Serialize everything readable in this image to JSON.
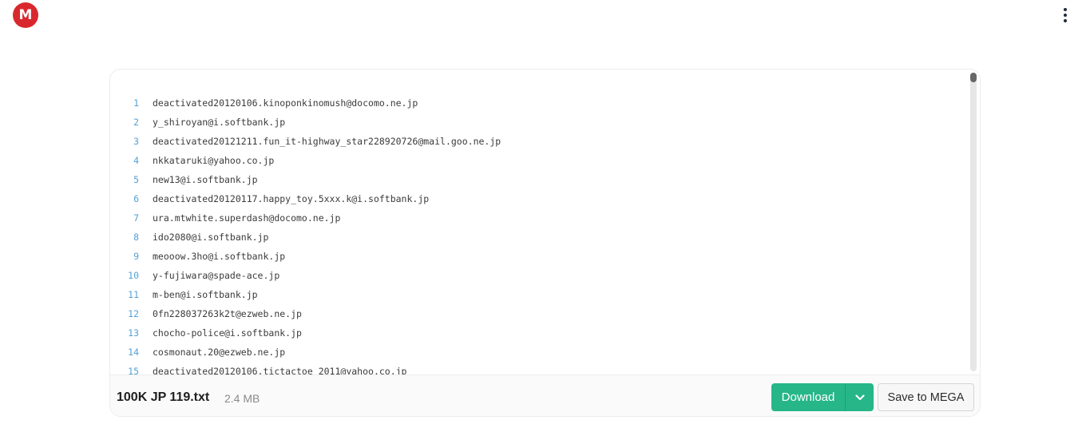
{
  "header": {
    "logo_letter": "M",
    "logo_color": "#d9272e",
    "menu_icon": "kebab-menu-icon"
  },
  "viewer": {
    "lines": [
      {
        "n": "1",
        "text": "deactivated20120106.kinoponkinomush@docomo.ne.jp"
      },
      {
        "n": "2",
        "text": "y_shiroyan@i.softbank.jp"
      },
      {
        "n": "3",
        "text": "deactivated20121211.fun_it-highway_star228920726@mail.goo.ne.jp"
      },
      {
        "n": "4",
        "text": "nkkataruki@yahoo.co.jp"
      },
      {
        "n": "5",
        "text": "new13@i.softbank.jp"
      },
      {
        "n": "6",
        "text": "deactivated20120117.happy_toy.5xxx.k@i.softbank.jp"
      },
      {
        "n": "7",
        "text": "ura.mtwhite.superdash@docomo.ne.jp"
      },
      {
        "n": "8",
        "text": "ido2080@i.softbank.jp"
      },
      {
        "n": "9",
        "text": "meooow.3ho@i.softbank.jp"
      },
      {
        "n": "10",
        "text": "y-fujiwara@spade-ace.jp"
      },
      {
        "n": "11",
        "text": "m-ben@i.softbank.jp"
      },
      {
        "n": "12",
        "text": "0fn228037263k2t@ezweb.ne.jp"
      },
      {
        "n": "13",
        "text": "chocho-police@i.softbank.jp"
      },
      {
        "n": "14",
        "text": "cosmonaut.20@ezweb.ne.jp"
      },
      {
        "n": "15",
        "text": "deactivated20120106.tictactoe_2011@yahoo.co.jp"
      }
    ]
  },
  "footer": {
    "file_name": "100K JP 119.txt",
    "file_size": "2.4 MB",
    "download_label": "Download",
    "save_label": "Save to MEGA",
    "accent_color": "#26b688"
  }
}
